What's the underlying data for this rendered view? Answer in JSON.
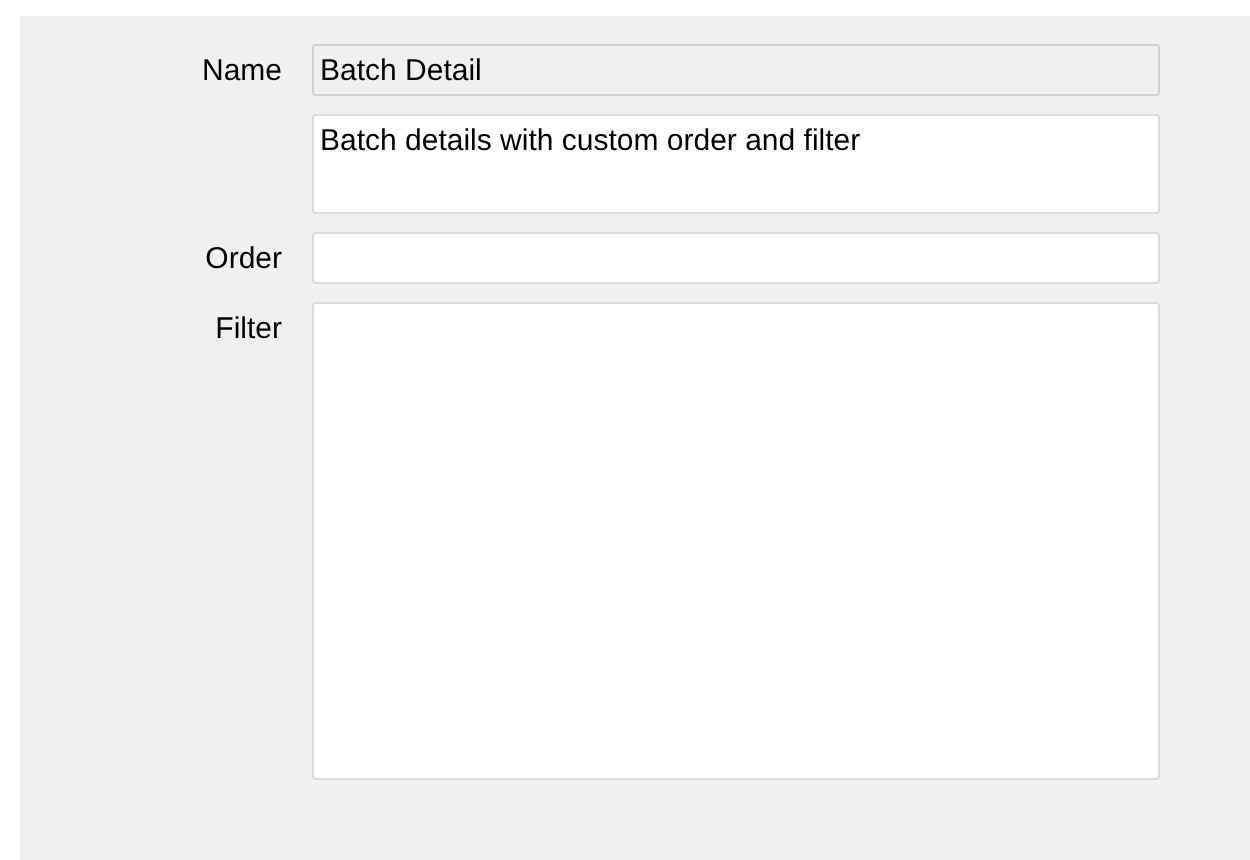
{
  "fields": [
    {
      "kind": "line",
      "label": "Name",
      "value": "Batch Detail",
      "disabled": true
    },
    {
      "kind": "note",
      "value": "Batch details with custom order and filter",
      "disabled": false
    },
    {
      "kind": "line",
      "label": "Order",
      "disabled": false
    },
    {
      "kind": "area",
      "label": "Filter",
      "disabled": false
    }
  ]
}
